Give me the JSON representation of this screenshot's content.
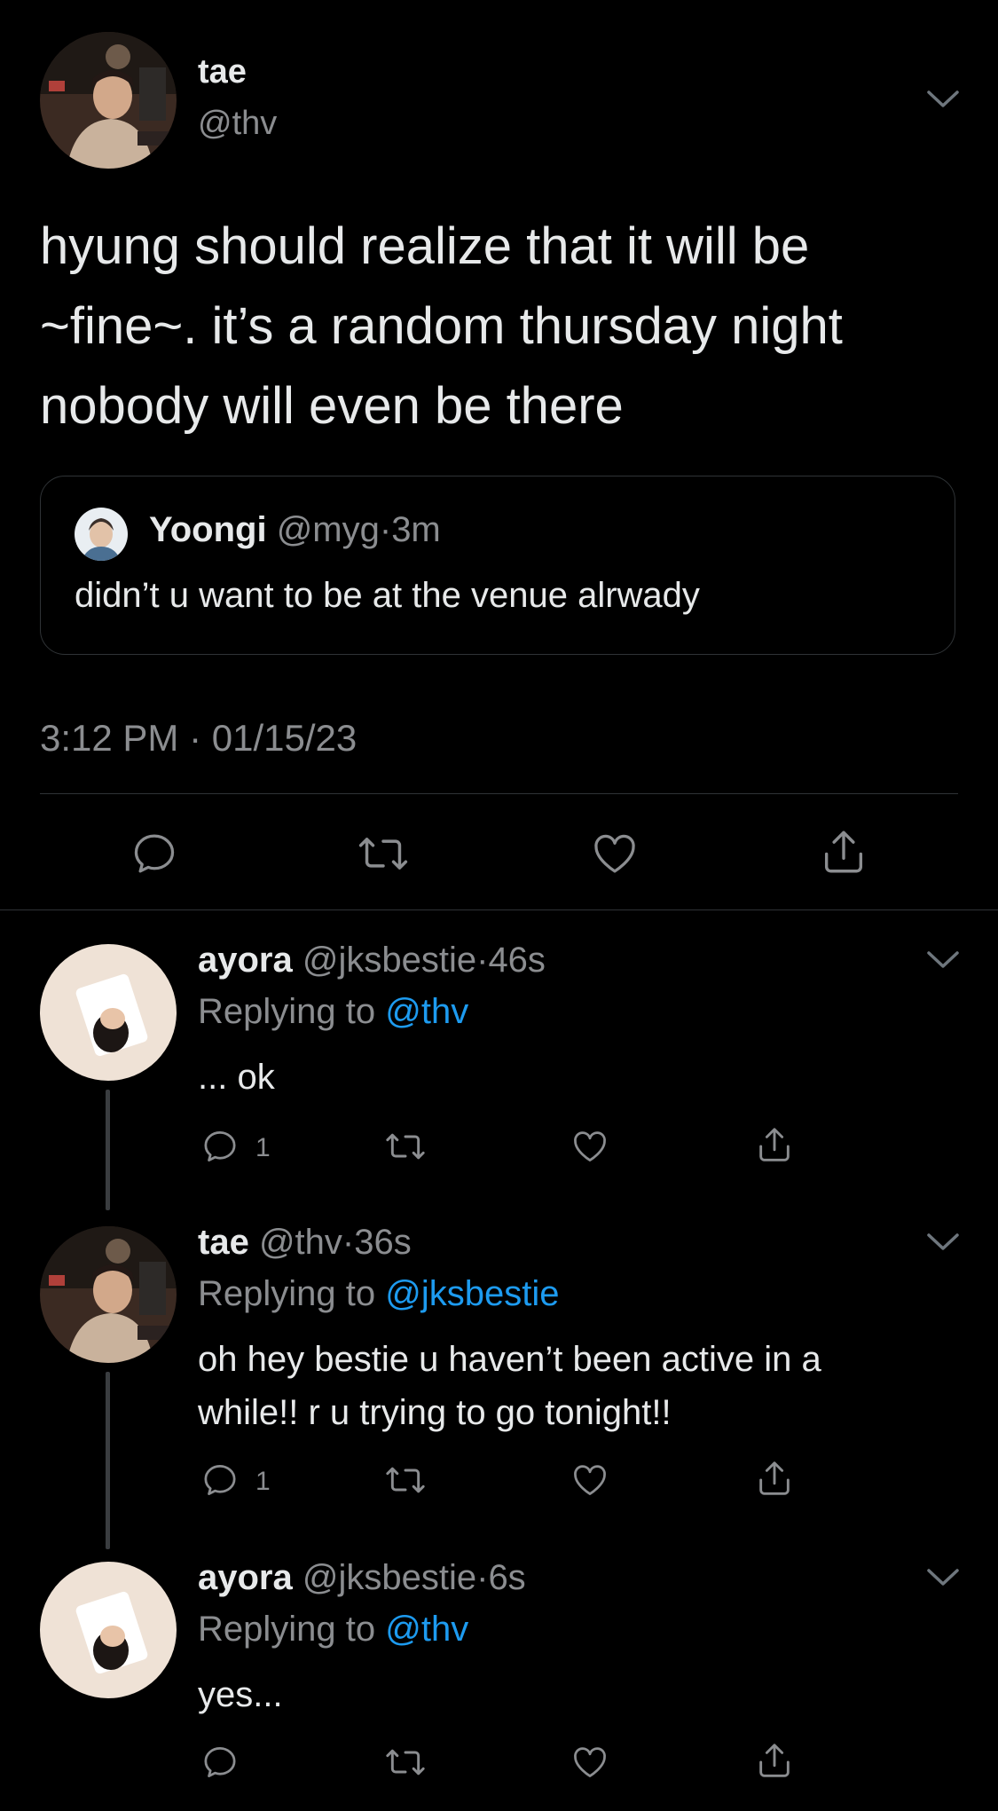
{
  "main_tweet": {
    "name": "tae",
    "handle": "@thv",
    "text_lines": [
      "hyung should realize that it will be",
      "~fine~. it’s a random thursday night",
      "nobody will even be there"
    ],
    "quote": {
      "name": "Yoongi",
      "handle": "@myg",
      "sep": "·",
      "time": "3m",
      "text": "didn’t u want to be at the venue alrwady"
    },
    "timestamp": "3:12 PM · 01/15/23"
  },
  "replies": [
    {
      "name": "ayora",
      "handle": "@jksbestie",
      "sep": "·",
      "time": "46s",
      "replying_prefix": "Replying to ",
      "replying_to": "@thv",
      "text_lines": [
        "... ok"
      ],
      "reply_count": "1"
    },
    {
      "name": "tae",
      "handle": "@thv",
      "sep": "·",
      "time": "36s",
      "replying_prefix": "Replying to ",
      "replying_to": "@jksbestie",
      "text_lines": [
        "oh hey bestie u haven’t been active in a",
        "while!! r u trying to go tonight!!"
      ],
      "reply_count": "1"
    },
    {
      "name": "ayora",
      "handle": "@jksbestie",
      "sep": "·",
      "time": "6s",
      "replying_prefix": "Replying to ",
      "replying_to": "@thv",
      "text_lines": [
        "yes..."
      ],
      "reply_count": ""
    }
  ],
  "icons": {
    "reply": "speech-bubble-icon",
    "retweet": "retweet-arrows-icon",
    "like": "heart-icon",
    "share": "share-upload-icon",
    "more": "chevron-down-icon"
  },
  "colors": {
    "background": "#000000",
    "text": "#e7e9ea",
    "secondary": "#8b8d90",
    "link": "#1d9bf0",
    "border": "#2f3336"
  }
}
